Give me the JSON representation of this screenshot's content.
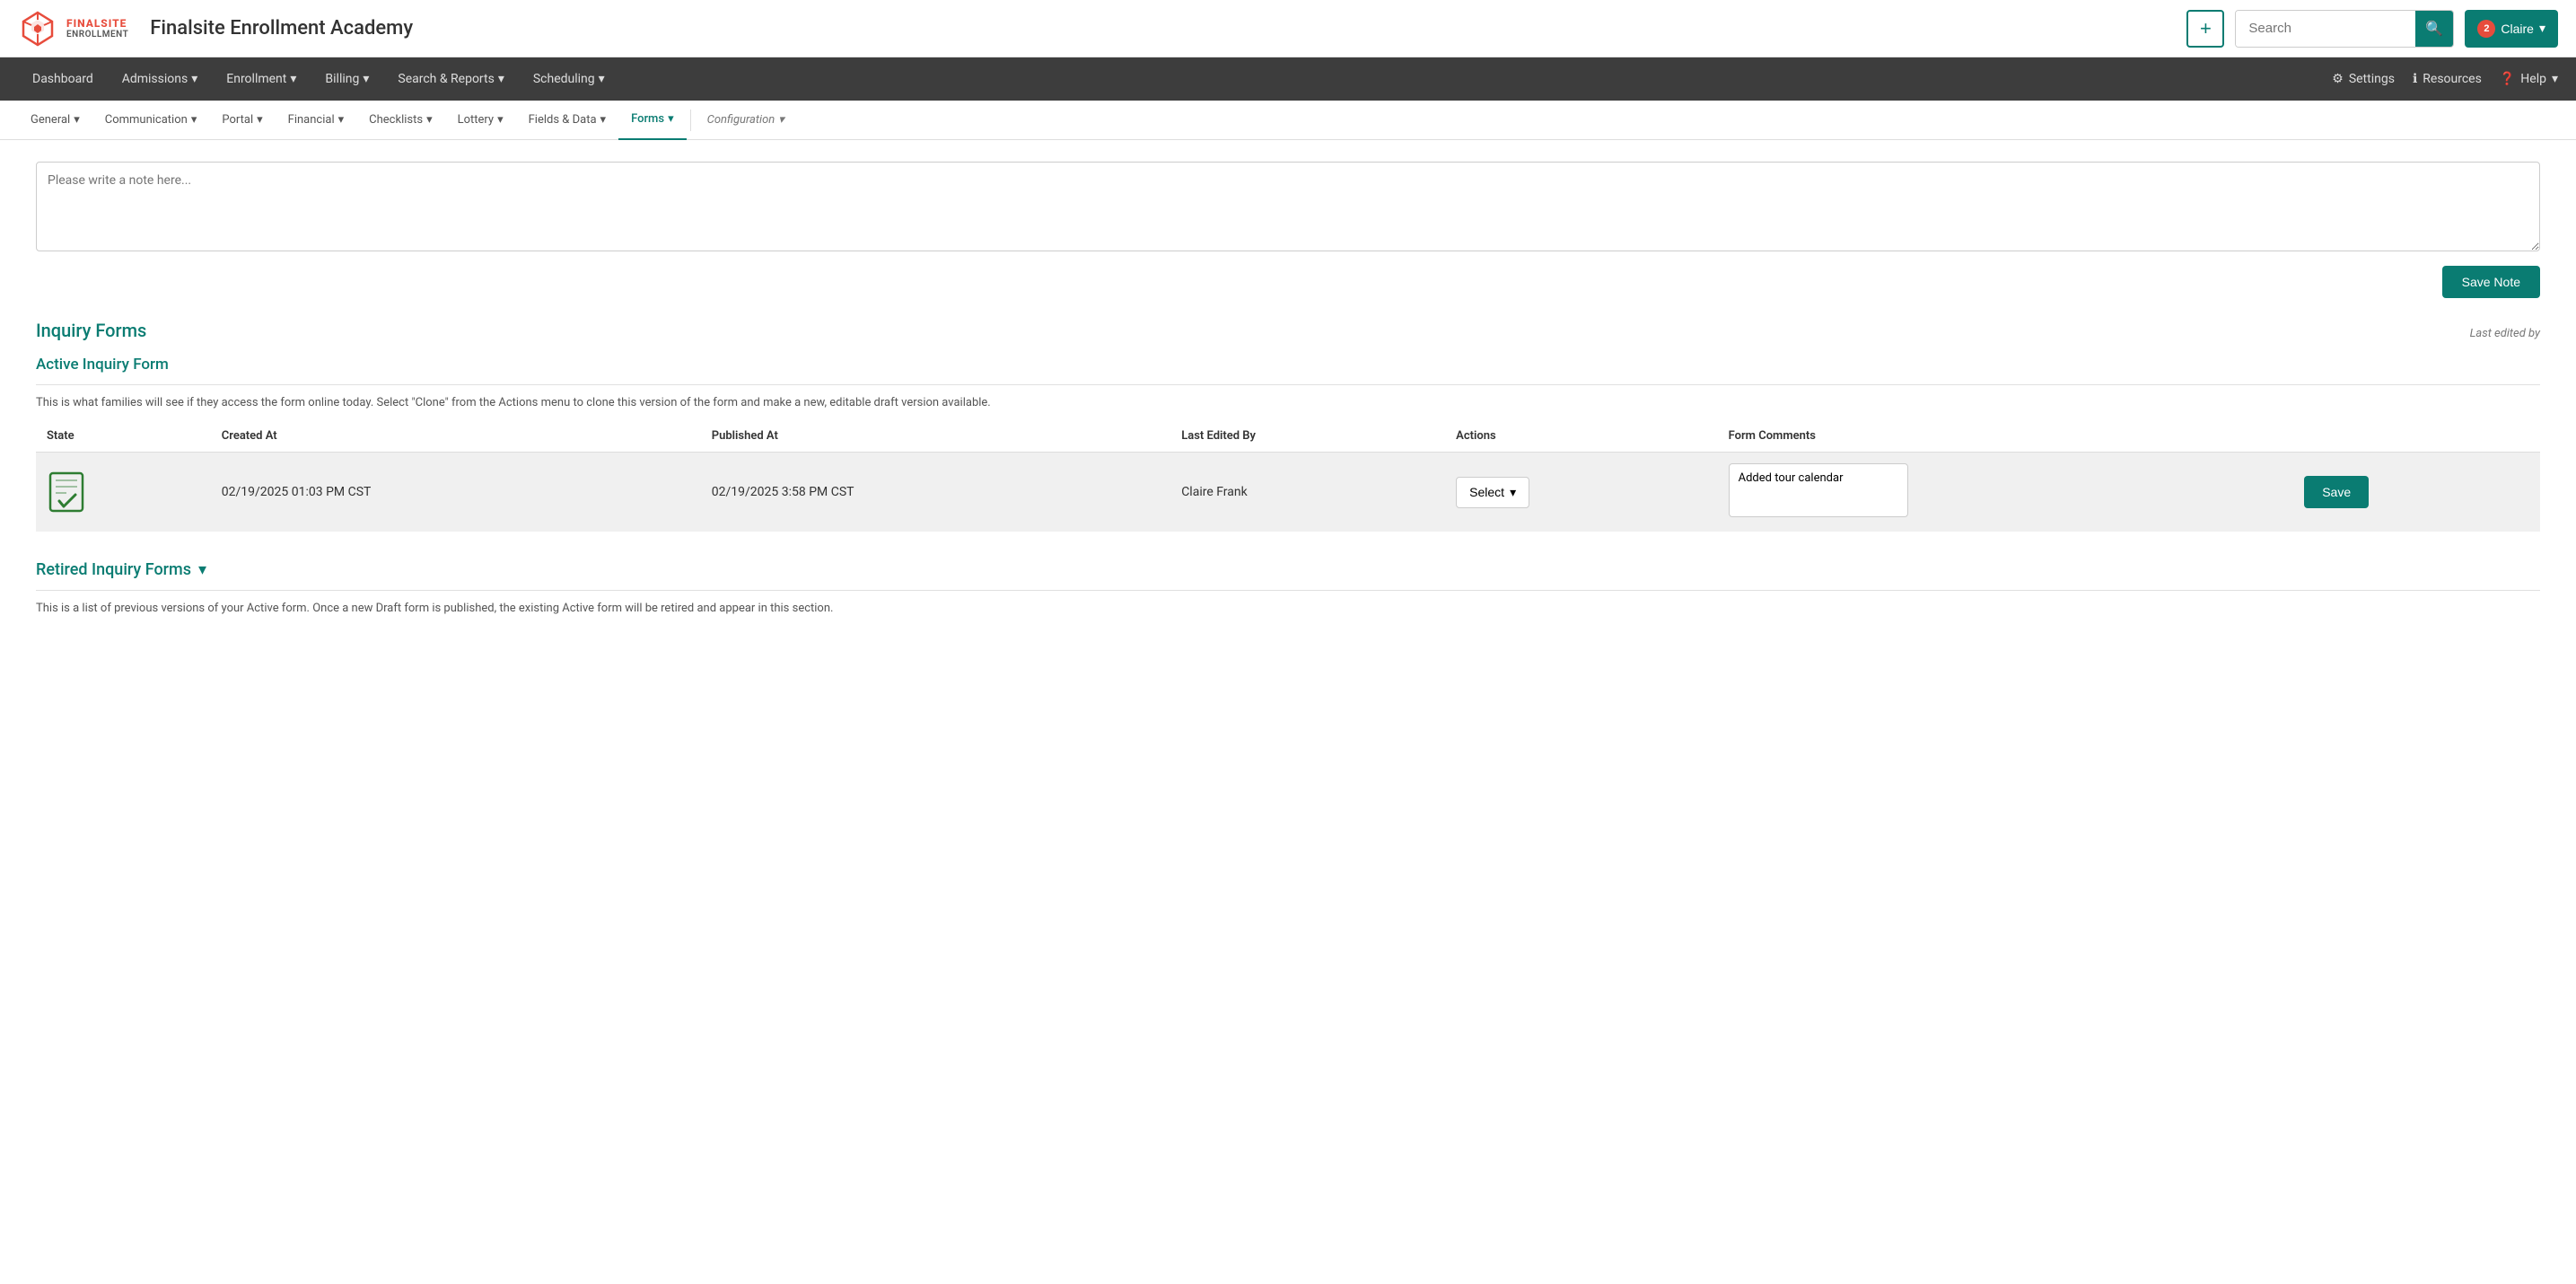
{
  "app": {
    "title": "Finalsite Enrollment Academy",
    "logo_text_line1": "FINALSITE",
    "logo_text_line2": "ENROLLMENT"
  },
  "header": {
    "add_button_label": "+",
    "search_placeholder": "Search",
    "search_button_icon": "🔍",
    "user_badge_count": "2",
    "user_name": "Claire",
    "user_chevron": "▾"
  },
  "main_nav": {
    "items": [
      {
        "label": "Dashboard",
        "has_dropdown": false
      },
      {
        "label": "Admissions",
        "has_dropdown": true
      },
      {
        "label": "Enrollment",
        "has_dropdown": true
      },
      {
        "label": "Billing",
        "has_dropdown": true
      },
      {
        "label": "Search & Reports",
        "has_dropdown": true
      },
      {
        "label": "Scheduling",
        "has_dropdown": true
      }
    ],
    "right_items": [
      {
        "label": "Settings",
        "icon": "⚙"
      },
      {
        "label": "Resources",
        "icon": "ℹ"
      },
      {
        "label": "Help",
        "icon": "❓",
        "has_dropdown": true
      }
    ]
  },
  "sub_nav": {
    "items": [
      {
        "label": "General",
        "has_dropdown": true,
        "active": false
      },
      {
        "label": "Communication",
        "has_dropdown": true,
        "active": false
      },
      {
        "label": "Portal",
        "has_dropdown": true,
        "active": false
      },
      {
        "label": "Financial",
        "has_dropdown": true,
        "active": false
      },
      {
        "label": "Checklists",
        "has_dropdown": true,
        "active": false
      },
      {
        "label": "Lottery",
        "has_dropdown": true,
        "active": false
      },
      {
        "label": "Fields & Data",
        "has_dropdown": true,
        "active": false
      },
      {
        "label": "Forms",
        "has_dropdown": true,
        "active": true
      }
    ],
    "config_item": {
      "label": "Configuration",
      "has_dropdown": true
    }
  },
  "content": {
    "note_placeholder": "Please write a note here...",
    "save_note_label": "Save Note",
    "inquiry_forms_title": "Inquiry Forms",
    "last_edited_label": "Last edited by",
    "active_form_title": "Active Inquiry Form",
    "active_form_description": "This is what families will see if they access the form online today. Select \"Clone\" from the Actions menu to clone this version of the form and make a new, editable draft version available.",
    "table": {
      "columns": [
        "State",
        "Created At",
        "Published At",
        "Last Edited By",
        "Actions",
        "Form Comments"
      ],
      "rows": [
        {
          "state_icon": "form-check-icon",
          "created_at": "02/19/2025 01:03 PM CST",
          "published_at": "02/19/2025 3:58 PM CST",
          "last_edited_by": "Claire Frank",
          "actions_label": "Select",
          "form_comment": "Added tour calendar",
          "save_label": "Save"
        }
      ]
    },
    "retired_title": "Retired Inquiry Forms",
    "retired_chevron": "▾",
    "retired_description": "This is a list of previous versions of your Active form. Once a new Draft form is published, the existing Active form will be retired and appear in this section."
  }
}
